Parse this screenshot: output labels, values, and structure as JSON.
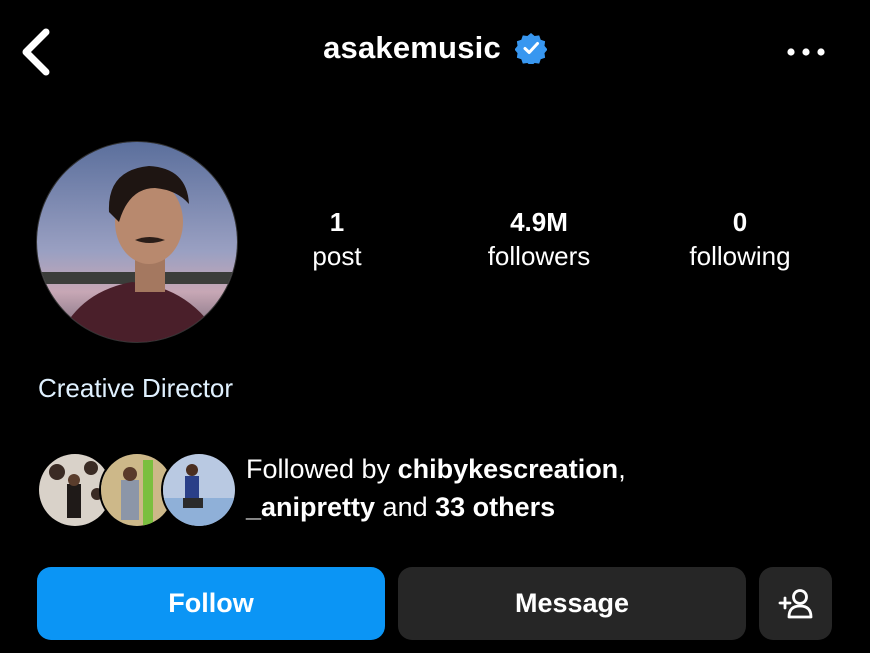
{
  "header": {
    "username": "asakemusic",
    "back_icon": "chevron-left-icon",
    "verified_icon": "verified-badge-icon",
    "more_icon": "more-horizontal-icon"
  },
  "stats": {
    "posts": {
      "value": "1",
      "label": "post"
    },
    "followers": {
      "value": "4.9M",
      "label": "followers"
    },
    "following": {
      "value": "0",
      "label": "following"
    }
  },
  "bio": "Creative Director",
  "followed_by": {
    "prefix": "Followed by ",
    "user1": "chibykescreation",
    "sep": ",",
    "user2": "_anipretty",
    "middle": " and ",
    "others": "33 others"
  },
  "actions": {
    "follow": "Follow",
    "message": "Message",
    "add_user_icon": "add-person-icon"
  },
  "colors": {
    "accent": "#0B95F5",
    "verified": "#3897F0",
    "button_dark": "#262626",
    "background": "#000000"
  }
}
